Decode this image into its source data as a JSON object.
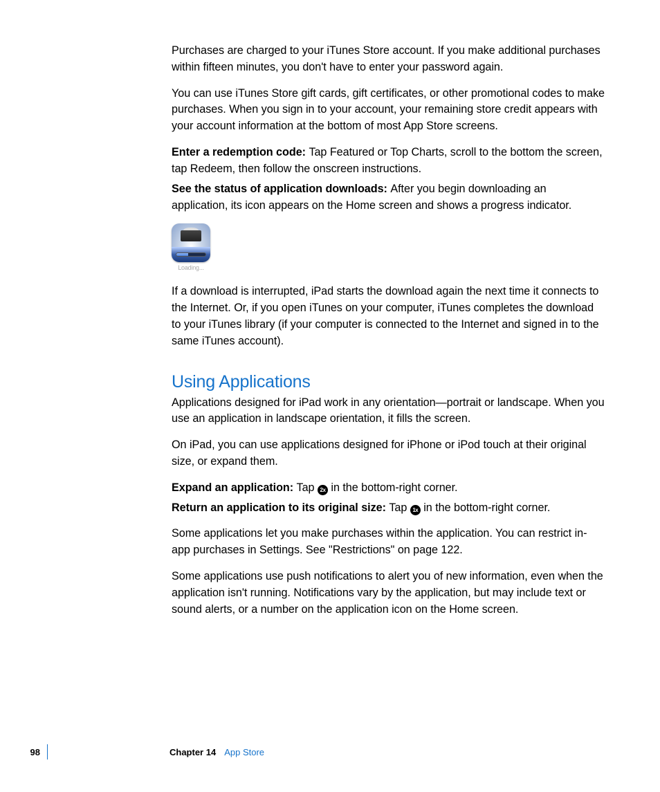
{
  "paragraphs": {
    "p1": "Purchases are charged to your iTunes Store account. If you make additional purchases within fifteen minutes, you don't have to enter your password again.",
    "p2": "You can use iTunes Store gift cards, gift certificates, or other promotional codes to make purchases. When you sign in to your account, your remaining store credit appears with your account information at the bottom of most App Store screens.",
    "p3_lead": "Enter a redemption code:  ",
    "p3_body": "Tap Featured or Top Charts, scroll to the bottom the screen, tap Redeem, then follow the onscreen instructions.",
    "p4_lead": "See the status of application downloads:  ",
    "p4_body": "After you begin downloading an application, its icon appears on the Home screen and shows a progress indicator.",
    "p5": "If a download is interrupted, iPad starts the download again the next time it connects to the Internet. Or, if you open iTunes on your computer, iTunes completes the download to your iTunes library (if your computer is connected to the Internet and signed in to the same iTunes account).",
    "p6": "Applications designed for iPad work in any orientation—portrait or landscape. When you use an application in landscape orientation, it fills the screen.",
    "p7": "On iPad, you can use applications designed for iPhone or iPod touch at their original size, or expand them.",
    "p8_lead": "Expand an application:  ",
    "p8_body_a": "Tap ",
    "p8_body_b": " in the bottom-right corner.",
    "p9_lead": "Return an application to its original size:  ",
    "p9_body_a": "Tap ",
    "p9_body_b": " in the bottom-right corner.",
    "p10": "Some applications let you make purchases within the application. You can restrict in-app purchases in Settings. See \"Restrictions\" on page 122.",
    "p11": "Some applications use push notifications to alert you of new information, even when the application isn't running. Notifications vary by the application, but may include text or sound alerts, or a number on the application icon on the Home screen."
  },
  "heading": "Using Applications",
  "icon": {
    "loading_label": "Loading...",
    "expand_label": "2x",
    "shrink_label": "1x"
  },
  "footer": {
    "page": "98",
    "chapter_label": "Chapter 14",
    "chapter_title": "App Store"
  }
}
